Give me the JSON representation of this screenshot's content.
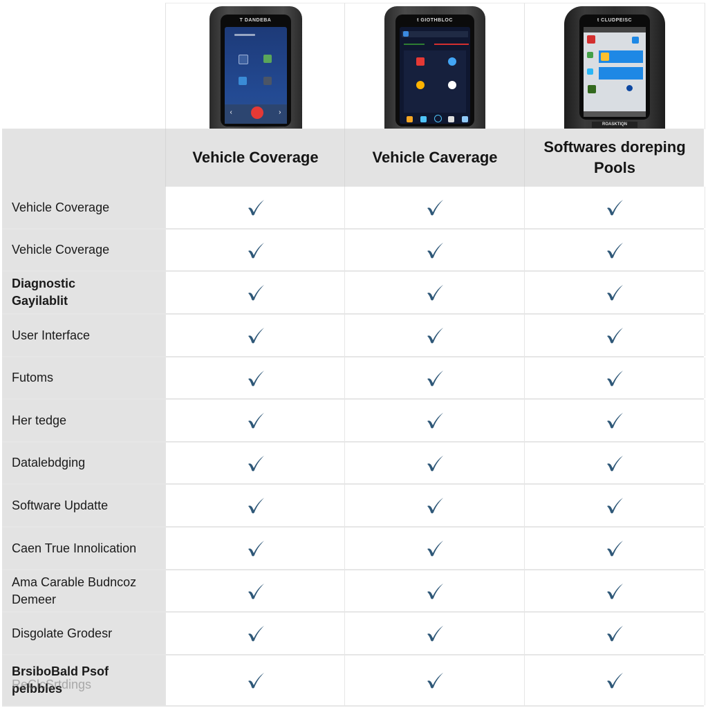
{
  "products": [
    {
      "header": "Vehicle Coverage",
      "device": {
        "brand_text": "T DANDEBA",
        "screen_theme": "blue"
      }
    },
    {
      "header": "Vehicle Caverage",
      "device": {
        "brand_text": "t GIOTHBLOC",
        "screen_theme": "dark"
      }
    },
    {
      "header": "Softwares doreping Pools",
      "device": {
        "brand_text": "t CLUDPEISC",
        "screen_theme": "light",
        "base_label": "ROASKTIQN"
      }
    }
  ],
  "features": [
    {
      "label": "Vehicle Coverage",
      "bold": false,
      "checks": [
        true,
        true,
        true
      ]
    },
    {
      "label": "Vehicle Coverage",
      "bold": false,
      "checks": [
        true,
        true,
        true
      ]
    },
    {
      "label": "Diagnostic Gayilablit",
      "bold": true,
      "checks": [
        true,
        true,
        true
      ]
    },
    {
      "label": "User Interface",
      "bold": false,
      "checks": [
        true,
        true,
        true
      ]
    },
    {
      "label": "Futoms",
      "bold": false,
      "checks": [
        true,
        true,
        true
      ]
    },
    {
      "label": "Her tedge",
      "bold": false,
      "checks": [
        true,
        true,
        true
      ]
    },
    {
      "label": "Datalebdging",
      "bold": false,
      "checks": [
        true,
        true,
        true
      ]
    },
    {
      "label": "Software Updatte",
      "bold": false,
      "checks": [
        true,
        true,
        true
      ]
    },
    {
      "label": "Caen True Innolication",
      "bold": false,
      "checks": [
        true,
        true,
        true
      ]
    },
    {
      "label": "Ama Carable Budncoz Demeer",
      "bold": false,
      "checks": [
        true,
        true,
        true
      ]
    },
    {
      "label": "Disgolate Grodesr",
      "bold": false,
      "checks": [
        true,
        true,
        true
      ]
    },
    {
      "label": "BrsiboBald Psof pelbbles",
      "bold": true,
      "ghost_text": "ReClcSrtdings",
      "checks": [
        true,
        true,
        true
      ]
    }
  ],
  "icons": {
    "check": "check-mark-icon"
  },
  "colors": {
    "check": "#2f5878",
    "feature_column_bg": "#e3e3e3",
    "header_bg": "#e3e3e3",
    "cell_bg": "#ffffff",
    "grid_line": "#e6e6e6"
  }
}
